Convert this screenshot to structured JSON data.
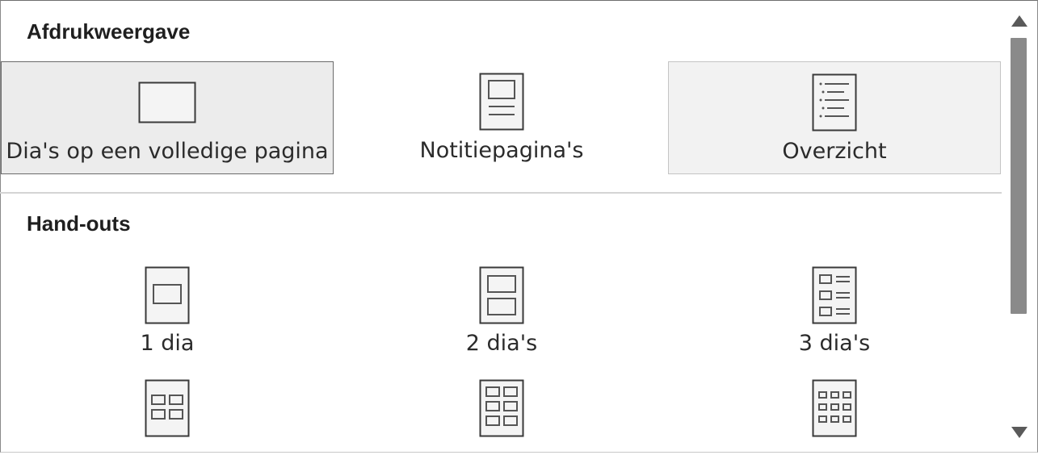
{
  "print_layout": {
    "heading": "Afdrukweergave",
    "options": [
      {
        "label": "Dia's op een volledige pagina",
        "icon": "full-page-slide-icon",
        "state": "selected"
      },
      {
        "label": "Notitiepagina's",
        "icon": "notes-page-icon",
        "state": "normal"
      },
      {
        "label": "Overzicht",
        "icon": "outline-icon",
        "state": "hover"
      }
    ]
  },
  "handouts": {
    "heading": "Hand-outs",
    "options": [
      {
        "label": "1 dia",
        "icon": "handout-1-slide-icon"
      },
      {
        "label": "2 dia's",
        "icon": "handout-2-slides-icon"
      },
      {
        "label": "3 dia's",
        "icon": "handout-3-slides-icon"
      },
      {
        "label": "",
        "icon": "handout-4-slides-icon"
      },
      {
        "label": "",
        "icon": "handout-6-slides-icon"
      },
      {
        "label": "",
        "icon": "handout-9-slides-icon"
      }
    ]
  },
  "scrollbar": {
    "up_icon": "scroll-up-arrow-icon",
    "down_icon": "scroll-down-arrow-icon"
  },
  "colors": {
    "selected_bg": "#ececec",
    "hover_bg": "#f2f2f2",
    "icon_stroke": "#3a3a3a",
    "thumb": "#8a8a8a"
  }
}
